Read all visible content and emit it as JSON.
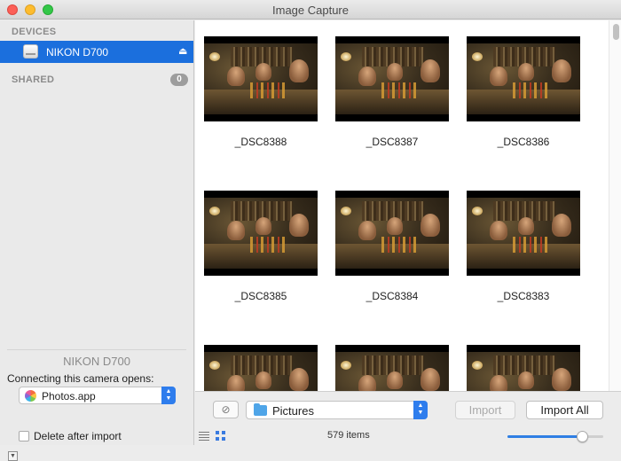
{
  "window": {
    "title": "Image Capture"
  },
  "sidebar": {
    "devices_header": "DEVICES",
    "device": {
      "name": "NIKON D700",
      "icon": "camera-drive-icon"
    },
    "shared_header": "SHARED",
    "shared_count": "0",
    "camera_name": "NIKON D700",
    "opens_label": "Connecting this camera opens:",
    "opens_app": "Photos.app",
    "delete_label": "Delete after import",
    "delete_checked": false
  },
  "photos": [
    {
      "name": "_DSC8388"
    },
    {
      "name": "_DSC8387"
    },
    {
      "name": "_DSC8386"
    },
    {
      "name": "_DSC8385"
    },
    {
      "name": "_DSC8384"
    },
    {
      "name": "_DSC8383"
    },
    {
      "name": ""
    },
    {
      "name": ""
    },
    {
      "name": ""
    }
  ],
  "toolbar": {
    "destination": "Pictures",
    "import_label": "Import",
    "import_all_label": "Import All",
    "item_count": "579 items",
    "thumbnail_size": 0.78
  },
  "colors": {
    "selection": "#1b6fdd",
    "accent": "#2f7fe4"
  }
}
